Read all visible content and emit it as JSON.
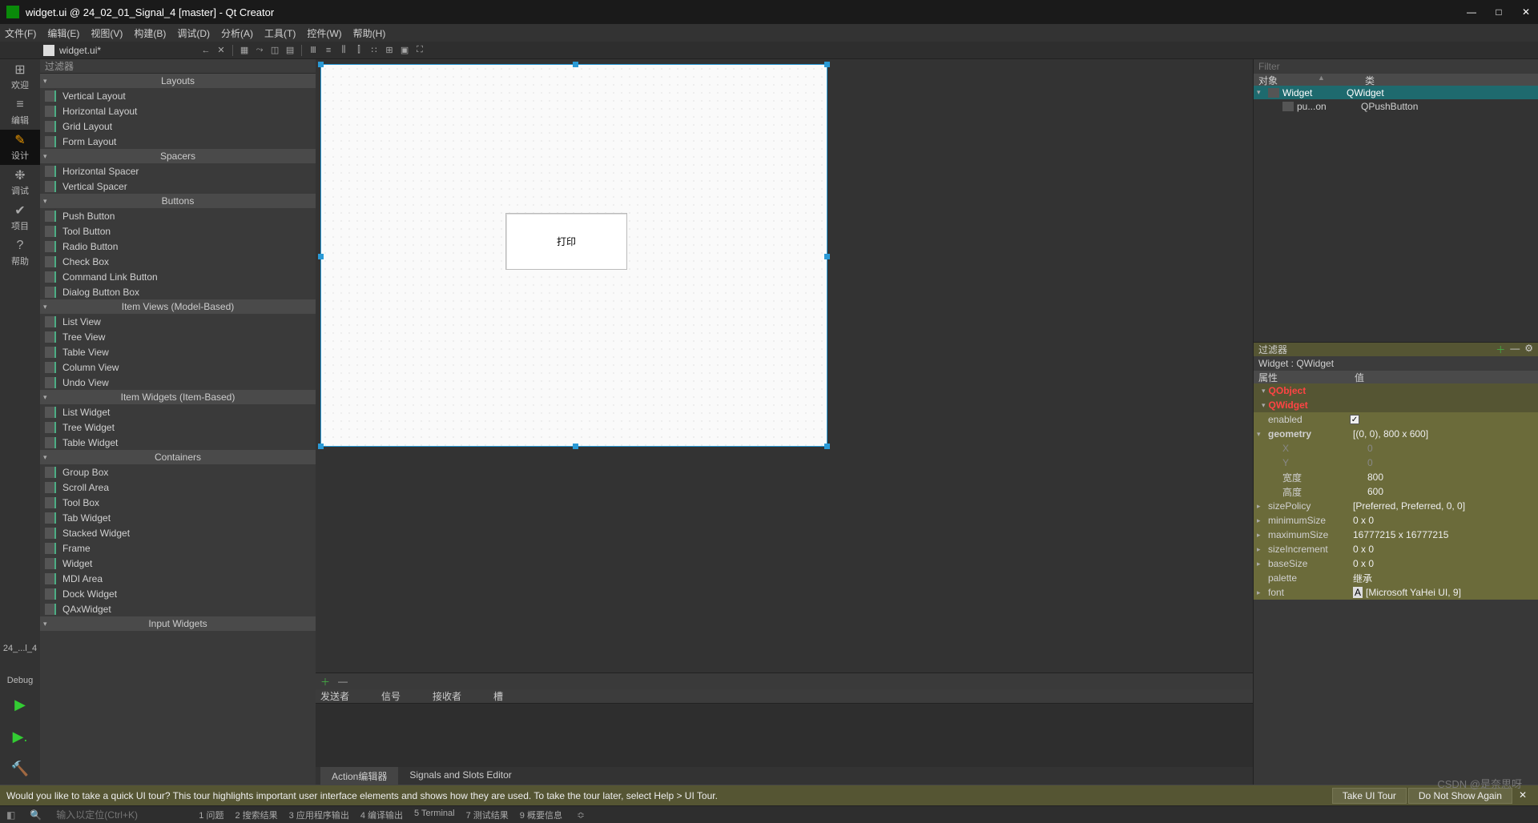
{
  "window": {
    "title": "widget.ui @ 24_02_01_Signal_4 [master] - Qt Creator"
  },
  "menus": [
    "文件(F)",
    "编辑(E)",
    "视图(V)",
    "构建(B)",
    "调试(D)",
    "分析(A)",
    "工具(T)",
    "控件(W)",
    "帮助(H)"
  ],
  "open_file": "widget.ui*",
  "rail": [
    {
      "icon": "⊞",
      "label": "欢迎"
    },
    {
      "icon": "≡",
      "label": "编辑"
    },
    {
      "icon": "✎",
      "label": "设计",
      "active": true
    },
    {
      "icon": "❉",
      "label": "调试"
    },
    {
      "icon": "✔",
      "label": "项目"
    },
    {
      "icon": "?",
      "label": "帮助"
    }
  ],
  "rail_bottom": [
    {
      "icon": "",
      "label": "24_...l_4"
    },
    {
      "icon": "",
      "label": "Debug"
    },
    {
      "icon": "▶",
      "label": "",
      "color": "#3c3"
    },
    {
      "icon": "▶.",
      "label": "",
      "color": "#3c3"
    },
    {
      "icon": "🔨",
      "label": ""
    }
  ],
  "widget_filter_label": "过滤器",
  "widget_categories": [
    {
      "name": "Layouts",
      "items": [
        "Vertical Layout",
        "Horizontal Layout",
        "Grid Layout",
        "Form Layout"
      ]
    },
    {
      "name": "Spacers",
      "items": [
        "Horizontal Spacer",
        "Vertical Spacer"
      ]
    },
    {
      "name": "Buttons",
      "items": [
        "Push Button",
        "Tool Button",
        "Radio Button",
        "Check Box",
        "Command Link Button",
        "Dialog Button Box"
      ]
    },
    {
      "name": "Item Views (Model-Based)",
      "items": [
        "List View",
        "Tree View",
        "Table View",
        "Column View",
        "Undo View"
      ]
    },
    {
      "name": "Item Widgets (Item-Based)",
      "items": [
        "List Widget",
        "Tree Widget",
        "Table Widget"
      ]
    },
    {
      "name": "Containers",
      "items": [
        "Group Box",
        "Scroll Area",
        "Tool Box",
        "Tab Widget",
        "Stacked Widget",
        "Frame",
        "Widget",
        "MDI Area",
        "Dock Widget",
        "QAxWidget"
      ]
    },
    {
      "name": "Input Widgets",
      "items": []
    }
  ],
  "canvas": {
    "button_text": "打印"
  },
  "signals": {
    "headers": [
      "发送者",
      "信号",
      "接收者",
      "槽"
    ],
    "tabs": [
      "Action编辑器",
      "Signals and Slots Editor"
    ],
    "active_tab": 0
  },
  "object_inspector": {
    "filter_placeholder": "Filter",
    "columns": [
      "对象",
      "类"
    ],
    "rows": [
      {
        "indent": 0,
        "name": "Widget",
        "cls": "QWidget",
        "selected": true,
        "expanded": true
      },
      {
        "indent": 1,
        "name": "pu...on",
        "cls": "QPushButton"
      }
    ]
  },
  "property_editor": {
    "filter_label": "过滤器",
    "path": "Widget : QWidget",
    "columns": [
      "属性",
      "值"
    ],
    "rows": [
      {
        "type": "class",
        "name": "QObject"
      },
      {
        "type": "class",
        "name": "QWidget"
      },
      {
        "type": "kv",
        "name": "enabled",
        "val_check": true
      },
      {
        "type": "kv",
        "name": "geometry",
        "val": "[(0, 0), 800 x 600]",
        "bold": true,
        "expanded": true
      },
      {
        "type": "kv",
        "name": "X",
        "val": "0",
        "sub": true,
        "dim": true
      },
      {
        "type": "kv",
        "name": "Y",
        "val": "0",
        "sub": true,
        "dim": true
      },
      {
        "type": "kv",
        "name": "宽度",
        "val": "800",
        "sub": true
      },
      {
        "type": "kv",
        "name": "高度",
        "val": "600",
        "sub": true
      },
      {
        "type": "kv",
        "name": "sizePolicy",
        "val": "[Preferred, Preferred, 0, 0]",
        "collapsed": true
      },
      {
        "type": "kv",
        "name": "minimumSize",
        "val": "0 x 0",
        "collapsed": true
      },
      {
        "type": "kv",
        "name": "maximumSize",
        "val": "16777215 x 16777215",
        "collapsed": true
      },
      {
        "type": "kv",
        "name": "sizeIncrement",
        "val": "0 x 0",
        "collapsed": true
      },
      {
        "type": "kv",
        "name": "baseSize",
        "val": "0 x 0",
        "collapsed": true
      },
      {
        "type": "kv",
        "name": "palette",
        "val": "继承"
      },
      {
        "type": "kv",
        "name": "font",
        "val": "[Microsoft YaHei UI, 9]",
        "collapsed": true,
        "icon": "A"
      }
    ]
  },
  "tour": {
    "text": "Would you like to take a quick UI tour? This tour highlights important user interface elements and shows how they are used. To take the tour later, select Help > UI Tour.",
    "btn1": "Take UI Tour",
    "btn2": "Do Not Show Again"
  },
  "statusbar": {
    "search_placeholder": "输入以定位(Ctrl+K)",
    "items": [
      "1 问题",
      "2 搜索结果",
      "3 应用程序输出",
      "4 编译输出",
      "5 Terminal",
      "7 测试结果",
      "9 概要信息"
    ]
  },
  "watermark": "CSDN @是奈思呀"
}
